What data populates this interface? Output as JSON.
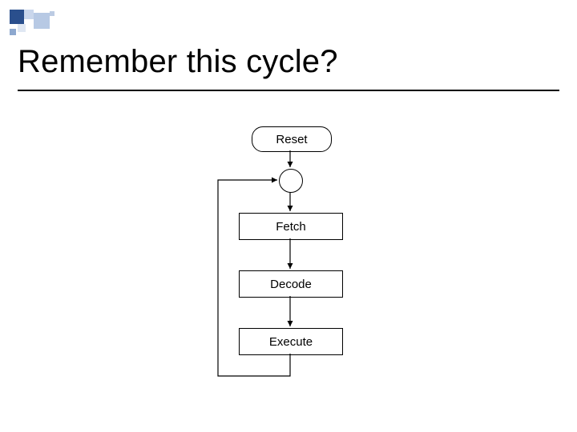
{
  "slide": {
    "title": "Remember this cycle?"
  },
  "flow": {
    "reset": "Reset",
    "fetch": "Fetch",
    "decode": "Decode",
    "execute": "Execute"
  },
  "colors": {
    "accent_dark": "#2a4f8d",
    "accent_light": "#c9d6ec"
  }
}
